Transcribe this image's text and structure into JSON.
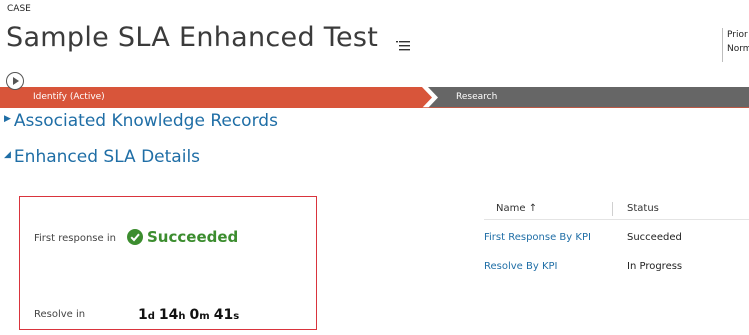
{
  "header": {
    "entity_label": "CASE",
    "title": "Sample SLA Enhanced Test",
    "priority_label": "Prior",
    "priority_value": "Norm"
  },
  "process": {
    "stages": [
      {
        "label": "Identify (Active)",
        "color": "#d8553a"
      },
      {
        "label": "Research",
        "color": "#666666"
      }
    ]
  },
  "sections": {
    "associated": "Associated Knowledge Records",
    "enhanced": "Enhanced SLA Details"
  },
  "kpi": {
    "first_response_label": "First response in",
    "first_response_status": "Succeeded",
    "resolve_label": "Resolve in",
    "resolve_timer": {
      "days": "1",
      "days_unit": "d",
      "hours": "14",
      "hours_unit": "h",
      "minutes": "0",
      "minutes_unit": "m",
      "seconds": "41",
      "seconds_unit": "s"
    }
  },
  "grid": {
    "columns": [
      "Name",
      "Status"
    ],
    "sort_indicator": "↑",
    "rows": [
      {
        "name": "First Response By KPI",
        "status": "Succeeded"
      },
      {
        "name": "Resolve By KPI",
        "status": "In Progress"
      }
    ]
  },
  "colors": {
    "accent": "#1f6ea6",
    "success": "#3c8d2f",
    "active_stage": "#d8553a",
    "inactive_stage": "#666666",
    "highlight_border": "#d9343d"
  }
}
